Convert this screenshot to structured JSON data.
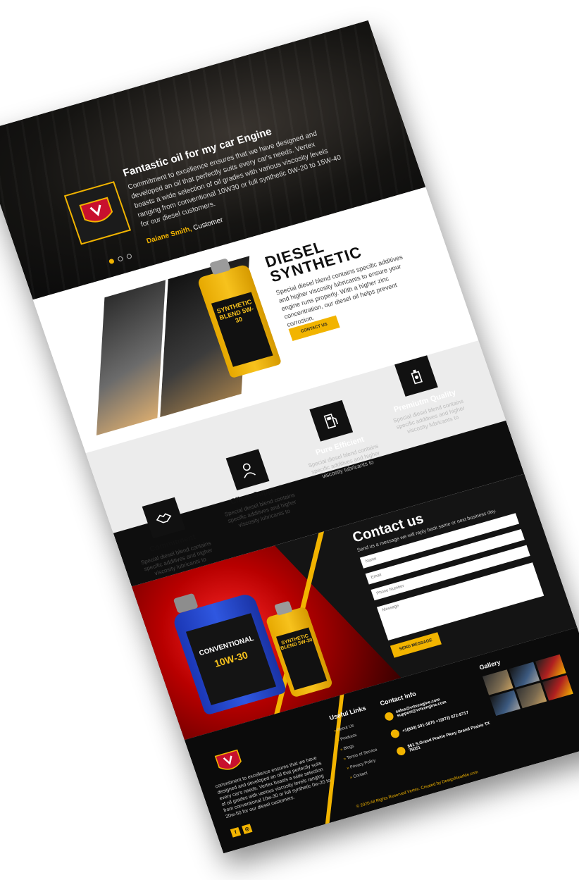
{
  "testimonial": {
    "title": "Fantastic oil for my car Engine",
    "text": "Commitment to excellence ensures that we have designed and developed an oil that perfectly suits every car's needs. Vertex boasts a wide selection of oil grades with various viscosity levels ranging from conventional 10W30 or full synthetic 0W-20 to 15W-40 for our diesel customers.",
    "author_name": "Daiane Smith,",
    "author_role": " Customer",
    "logo_text": "VERTEX"
  },
  "diesel": {
    "title": "DIESEL SYNTHETIC",
    "desc": "Special diesel blend contains specific additives and higher viscosity lubricants to ensure your engine runs properly. With a higher zinc concentration, our diesel oil helps prevent corrosion.",
    "button": "CONTACT US",
    "bottle_label": "SYNTHETIC BLEND 5W-30"
  },
  "features": [
    {
      "title": "Commitment",
      "text": "Special diesel blend contains specific additives and higher viscosity lubricants to",
      "icon": "handshake-icon"
    },
    {
      "title": "Client Support",
      "text": "Special diesel blend contains specific additives and higher viscosity lubricants to",
      "icon": "user-support-icon"
    },
    {
      "title": "Pure Efficient",
      "text": "Special diesel blend contains specific additives and higher viscosity lubricants to",
      "icon": "fuel-pump-icon"
    },
    {
      "title": "Premiutm Quality",
      "text": "Special diesel blend contains specific additives and higher viscosity lubricants to",
      "icon": "oil-can-icon"
    }
  ],
  "contact": {
    "title": "Contact us",
    "subtitle": "Send us a message we will reply back same or next business day.",
    "name_placeholder": "Name",
    "email_placeholder": "Email",
    "phone_placeholder": "Phone Number",
    "message_placeholder": "Message",
    "button": "SEND MESSAGE",
    "jug_blue_label": "CONVENTIONAL",
    "jug_blue_grade": "10W-30",
    "jug_yellow_label": "SYNTHETIC BLEND 5W-30"
  },
  "footer": {
    "about": "commitment to excellence ensures that we have designed and developed an oil that perfectly suits every car's needs. Vertex boasts a wide selection of oil grades with various viscosity levels ranging from conventional 10w-30 or full synthetic 0w-20 to 20w-50 for our diesel customers.",
    "useful_links_title": "Useful Links",
    "links": [
      "About Us",
      "Products",
      "Blogs",
      "Terms of Service",
      "Privacy Policy",
      "Contact"
    ],
    "contact_title": "Contact info",
    "email": "sales@vrtxengine.com support@vrtxengine.com",
    "phone": "+1(800) 501-1876 +1(972) 672-8717",
    "address": "861 S.Grand Prairie Pkwy Grand Prairie TX 75051",
    "gallery_title": "Gallery",
    "copyright": "© 2020 All Rights Reserved Vertex. Created by DesignNearMe.com",
    "social": [
      "f",
      "◎"
    ]
  },
  "colors": {
    "accent": "#f2b400",
    "dark": "#111111"
  }
}
